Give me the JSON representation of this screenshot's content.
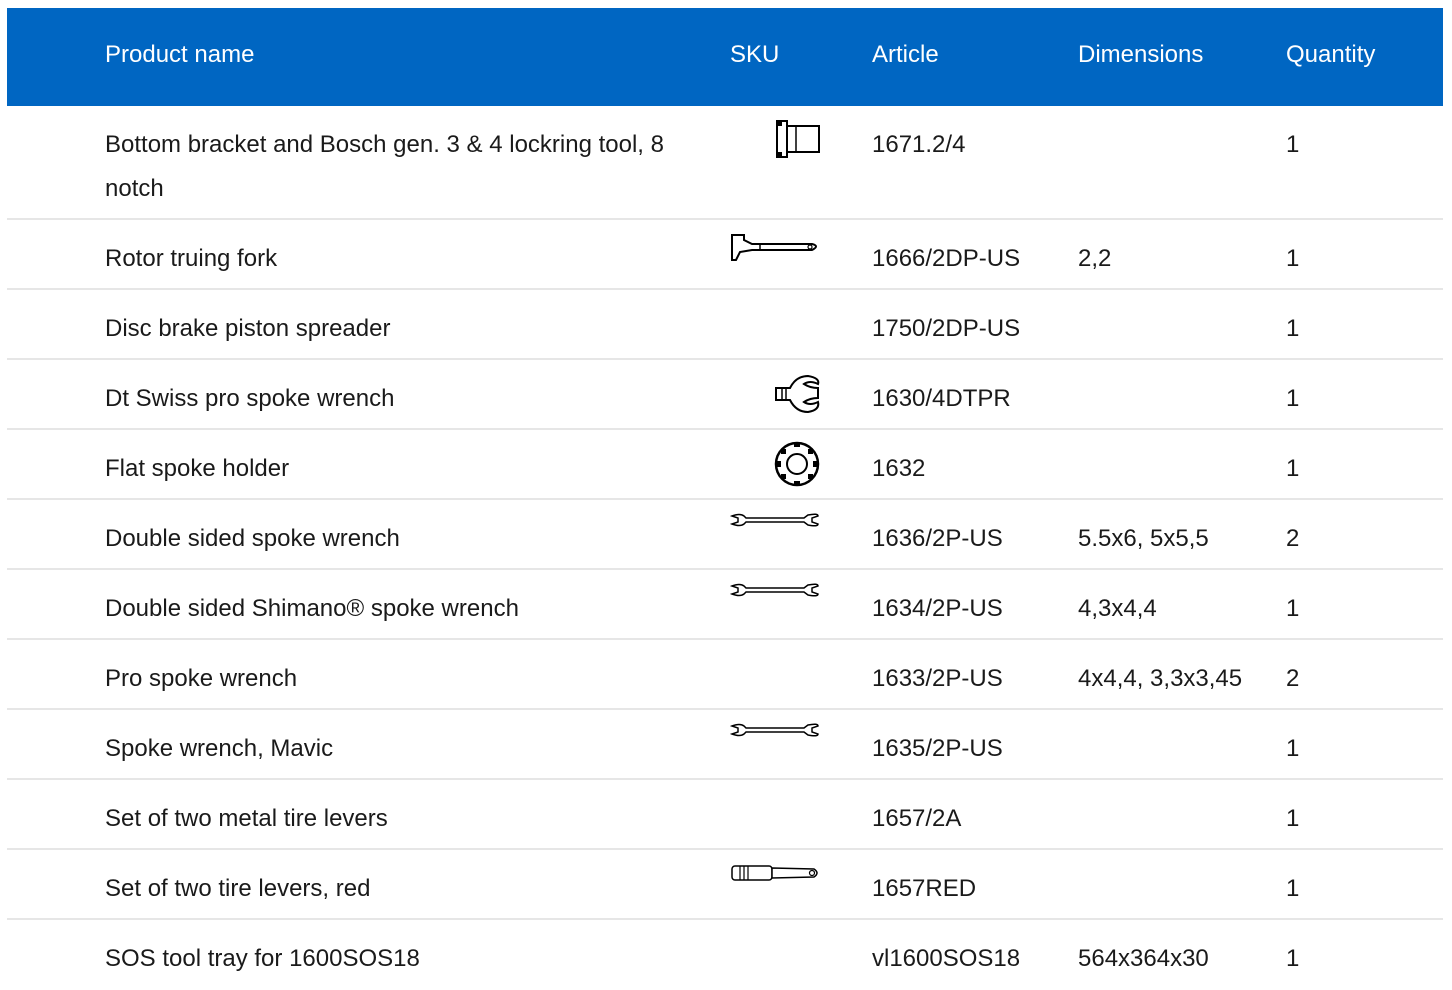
{
  "header": {
    "product_name": "Product name",
    "sku": "SKU",
    "article": "Article",
    "dimensions": "Dimensions",
    "quantity": "Quantity"
  },
  "rows": [
    {
      "name": "Bottom bracket and Bosch gen. 3 & 4 lockring tool, 8 notch",
      "icon": "lockring-tool-icon",
      "article": "1671.2/4",
      "dimensions": "",
      "quantity": "1"
    },
    {
      "name": "Rotor truing fork",
      "icon": "truing-fork-icon",
      "article": "1666/2DP-US",
      "dimensions": "2,2",
      "quantity": "1"
    },
    {
      "name": "Disc brake piston spreader",
      "icon": "",
      "article": "1750/2DP-US",
      "dimensions": "",
      "quantity": "1"
    },
    {
      "name": "Dt Swiss pro spoke wrench",
      "icon": "pro-spoke-wrench-icon",
      "article": "1630/4DTPR",
      "dimensions": "",
      "quantity": "1"
    },
    {
      "name": "Flat spoke holder",
      "icon": "spoke-holder-icon",
      "article": "1632",
      "dimensions": "",
      "quantity": "1"
    },
    {
      "name": "Double sided spoke wrench",
      "icon": "double-wrench-icon",
      "article": "1636/2P-US",
      "dimensions": "5.5x6, 5x5,5",
      "quantity": "2"
    },
    {
      "name": "Double sided Shimano® spoke wrench",
      "icon": "double-wrench-icon",
      "article": "1634/2P-US",
      "dimensions": "4,3x4,4",
      "quantity": "1"
    },
    {
      "name": "Pro spoke wrench",
      "icon": "",
      "article": "1633/2P-US",
      "dimensions": "4x4,4, 3,3x3,45",
      "quantity": "2"
    },
    {
      "name": "Spoke wrench, Mavic",
      "icon": "double-wrench-icon",
      "article": "1635/2P-US",
      "dimensions": "",
      "quantity": "1"
    },
    {
      "name": "Set of two metal tire levers",
      "icon": "",
      "article": "1657/2A",
      "dimensions": "",
      "quantity": "1"
    },
    {
      "name": "Set of two tire levers, red",
      "icon": "tire-lever-icon",
      "article": "1657RED",
      "dimensions": "",
      "quantity": "1"
    },
    {
      "name": "SOS tool tray for 1600SOS18",
      "icon": "",
      "article": "vl1600SOS18",
      "dimensions": "564x364x30",
      "quantity": "1"
    }
  ],
  "colors": {
    "header_bg": "#0066c2",
    "header_text": "#ffffff",
    "row_border": "#e6e6e6"
  }
}
